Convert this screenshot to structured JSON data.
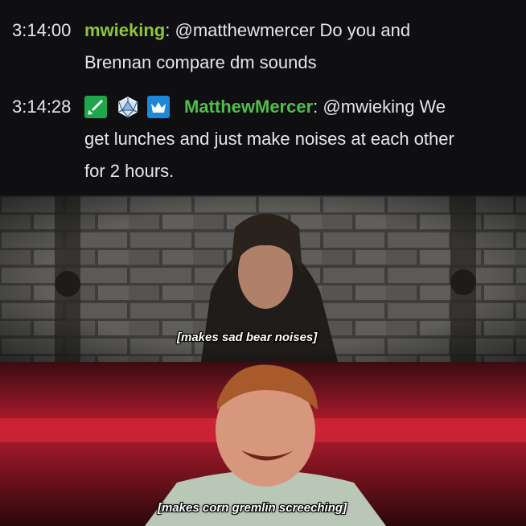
{
  "chat": {
    "messages": [
      {
        "timestamp": "3:14:00",
        "username": "mwieking",
        "username_color": "#8fc43c",
        "badges": [],
        "separator": ":",
        "text_line1": "@matthewmercer Do you and",
        "text_line2": "Brennan compare dm sounds"
      },
      {
        "timestamp": "3:14:28",
        "username": "MatthewMercer",
        "username_color": "#4fbf4a",
        "badges": [
          "sword-badge-icon",
          "d20-badge-icon",
          "crown-badge-icon"
        ],
        "separator": ":",
        "text_line1": "@mwieking We",
        "text_line2": "get lunches and just make noises at each other",
        "text_line3": "for 2 hours."
      }
    ]
  },
  "panels": [
    {
      "caption": "[makes sad bear noises]",
      "background": "brick wall"
    },
    {
      "caption": "[makes corn gremlin screeching]",
      "background": "red studio"
    }
  ],
  "colors": {
    "chat_bg": "#0f0f11",
    "text": "#e6e6ea",
    "sword_badge": "#1fa64a",
    "crown_badge": "#1e88d8"
  }
}
